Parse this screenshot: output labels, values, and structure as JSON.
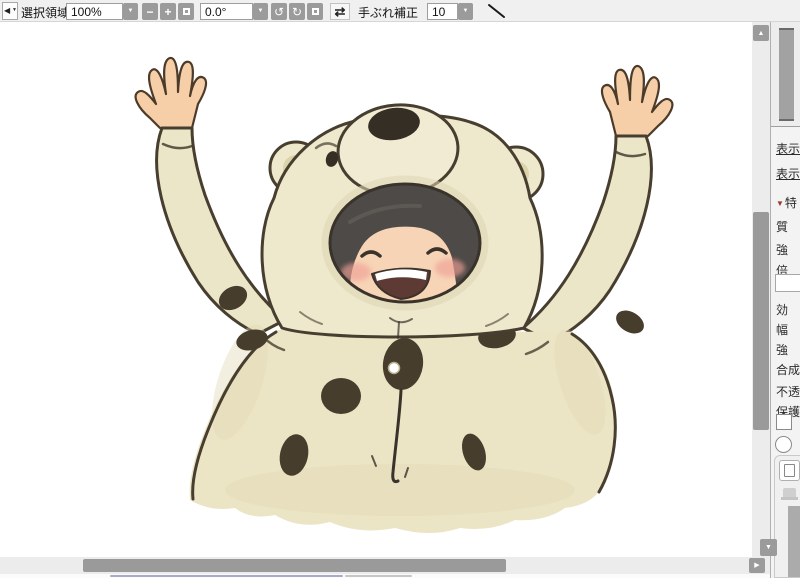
{
  "toolbar": {
    "selection_label": "選択領域",
    "zoom_value": "100%",
    "rotation_value": "0.0°",
    "stabilization_label": "手ぶれ補正",
    "stabilization_value": "10"
  },
  "icons": {
    "tool_arrow": "◀",
    "chevron_down": "▼",
    "minus": "−",
    "plus": "+",
    "rotate_ccw": "↺",
    "rotate_cw": "↻",
    "flip_horizontal": "⇄",
    "scroll_up": "▲",
    "scroll_down": "▼",
    "scroll_right": "▶"
  },
  "canvas": {
    "description": "Watercolor illustration of a smiling child in a cream bear kigurumi costume with dark brown spots, both arms raised in cheer"
  },
  "right_panel": {
    "link1": "表示",
    "link2": "表示",
    "section_marker": "▼",
    "section_label": "特",
    "rows": [
      "質",
      "強",
      "倍",
      "効",
      "幅",
      "強",
      "合成",
      "不透",
      "保護"
    ]
  },
  "colors": {
    "toolbar_bg": "#f0f0f0",
    "button_gray": "#9b9b9b",
    "scrollbar_thumb": "#9a9a9a",
    "section_marker_red": "#9c392f",
    "bottom_accent_blue": "#a9a9ce",
    "costume_cream": "#ebe5c5",
    "spot_brown": "#473d2d"
  }
}
